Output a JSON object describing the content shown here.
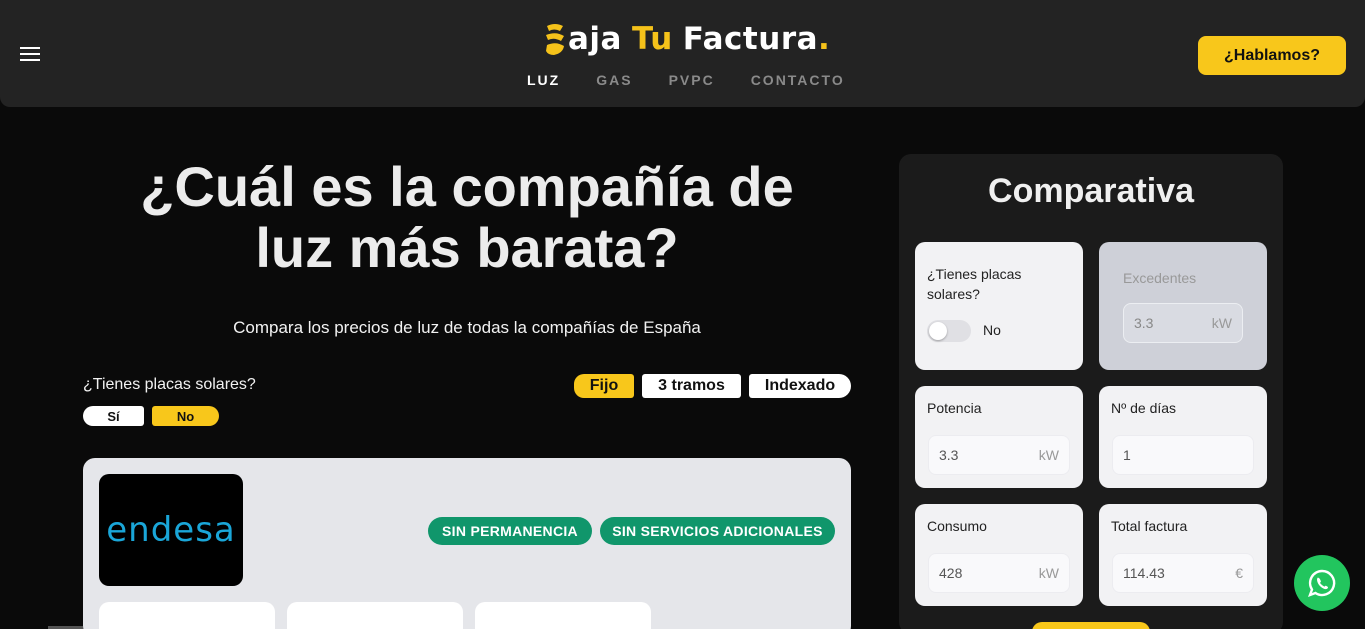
{
  "header": {
    "logo": {
      "word1": "aja",
      "word2": "Tu",
      "word3": "Factura",
      "dot": "."
    },
    "nav": [
      {
        "label": "LUZ",
        "active": true
      },
      {
        "label": "GAS",
        "active": false
      },
      {
        "label": "PVPC",
        "active": false
      },
      {
        "label": "CONTACTO",
        "active": false
      }
    ],
    "cta_label": "¿Hablamos?"
  },
  "hero": {
    "title_line1": "¿Cuál es la compañía de",
    "title_line2": "luz más barata?",
    "subtitle": "Compara los precios de luz de todas la compañías de España"
  },
  "filters": {
    "solar_question": "¿Tienes placas solares?",
    "yes_label": "Sí",
    "no_label": "No",
    "selected_solar": "No",
    "tariffs": [
      "Fijo",
      "3 tramos",
      "Indexado"
    ],
    "selected_tariff": "Fijo"
  },
  "offer": {
    "brand": "endesa",
    "tags": [
      "SIN PERMANENCIA",
      "SIN SERVICIOS ADICIONALES"
    ]
  },
  "comparativa": {
    "title": "Comparativa",
    "solar": {
      "label": "¿Tienes placas solares?",
      "toggle_value": "No"
    },
    "excedentes": {
      "label": "Excedentes",
      "value": "3.3",
      "unit": "kW"
    },
    "potencia": {
      "label": "Potencia",
      "value": "3.3",
      "unit": "kW"
    },
    "dias": {
      "label": "Nº de días",
      "value": "1"
    },
    "consumo": {
      "label": "Consumo",
      "value": "428",
      "unit": "kW"
    },
    "total": {
      "label": "Total factura",
      "value": "114.43",
      "unit": "€"
    }
  },
  "colors": {
    "accent": "#f8c71b",
    "tag_green": "#10966b",
    "whatsapp": "#22c55e",
    "header_bg": "#232323"
  },
  "icons": [
    "menu-icon",
    "logo-mark-icon",
    "whatsapp-icon"
  ]
}
